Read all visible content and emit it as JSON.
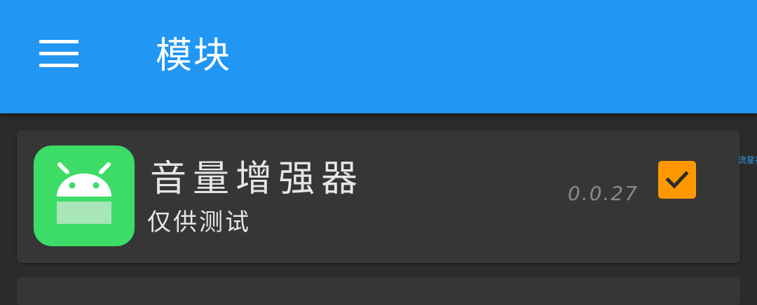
{
  "app_bar": {
    "title": "模块",
    "menu_icon": "hamburger-menu-icon",
    "background_color": "#2196f3"
  },
  "modules": [
    {
      "name": "音量增强器",
      "description": "仅供测试",
      "version": "0.0.27",
      "enabled": true,
      "icon": "android-icon",
      "icon_color": "#3ddc66",
      "checkbox_color": "#ff9800"
    }
  ],
  "watermark": "流星社区"
}
